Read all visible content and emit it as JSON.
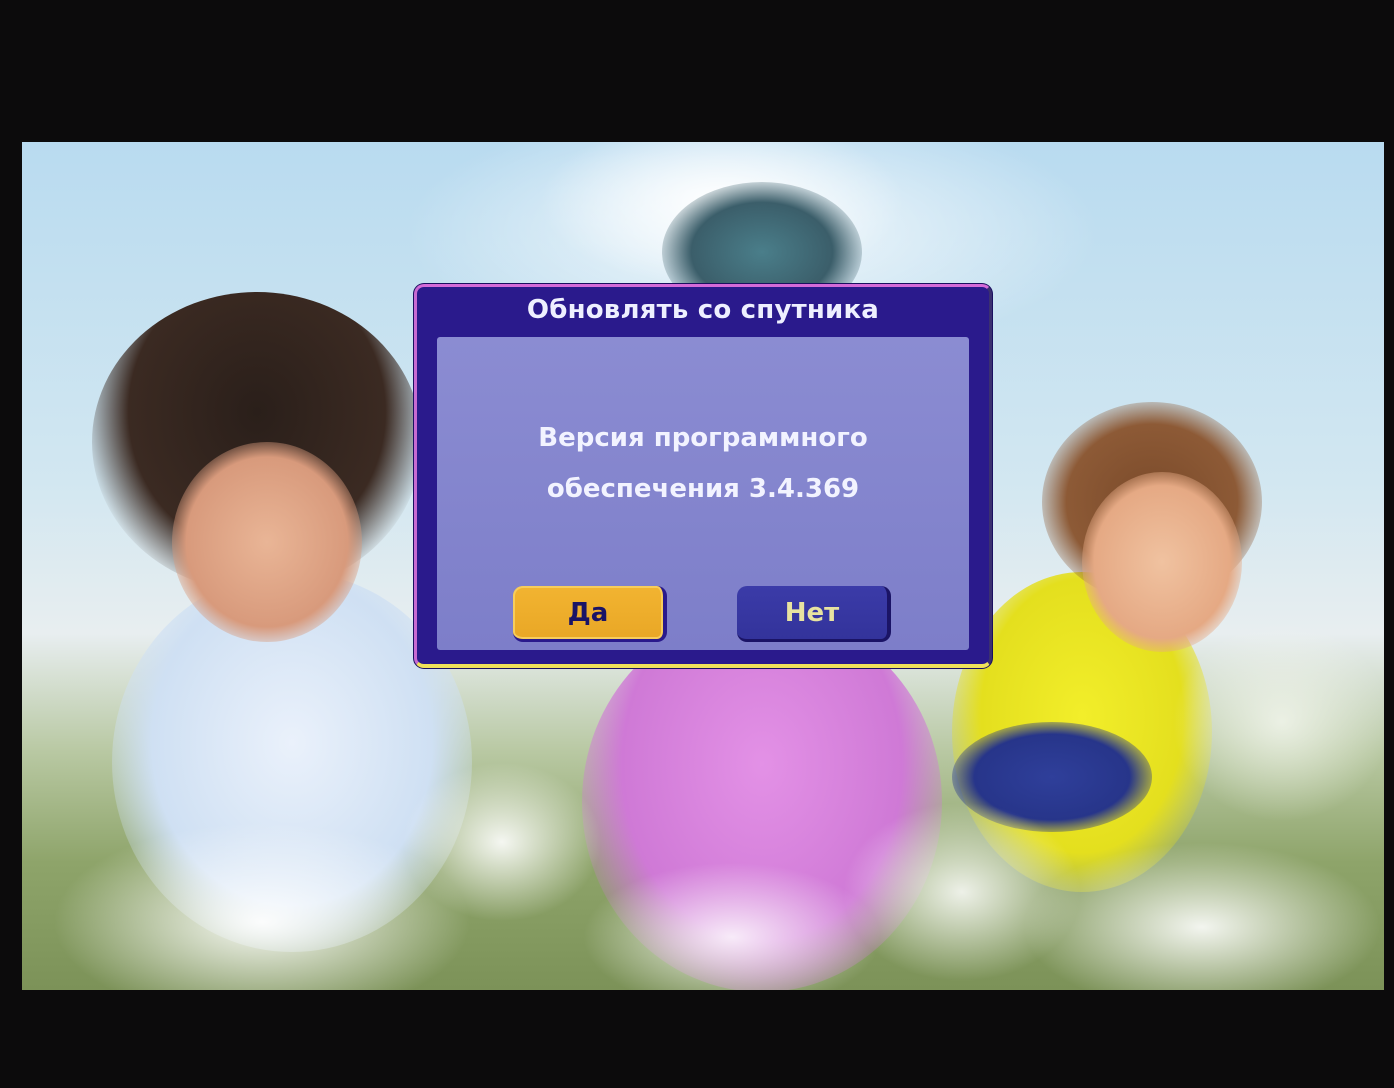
{
  "dialog": {
    "title": "Обновлять со спутника",
    "message_line1": "Версия программного",
    "message_line2": "обеспечения 3.4.369",
    "buttons": {
      "yes_label": "Да",
      "no_label": "Нет",
      "selected": "yes"
    }
  },
  "colors": {
    "dialog_frame": "#2a1a8c",
    "dialog_body": "#8b8cd2",
    "button_selected": "#f2b431",
    "button_normal": "#3b3ba8"
  }
}
